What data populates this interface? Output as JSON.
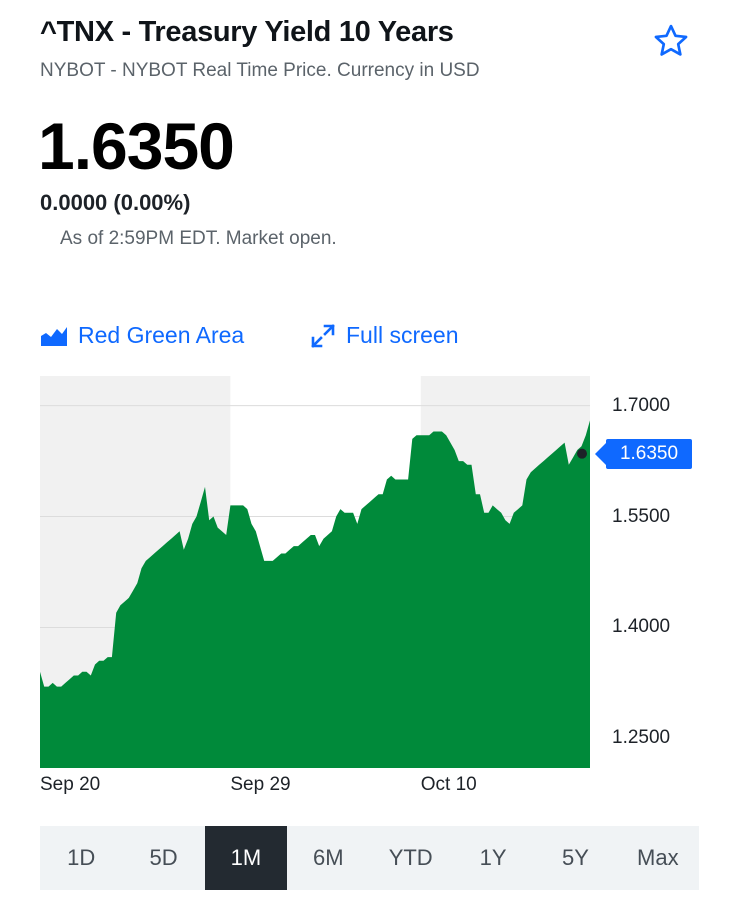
{
  "header": {
    "title": "^TNX - Treasury Yield 10 Years",
    "subtitle": "NYBOT - NYBOT Real Time Price. Currency in USD"
  },
  "quote": {
    "price": "1.6350",
    "change": "0.0000 (0.00%)",
    "as_of": "As of 2:59PM EDT. Market open."
  },
  "chart_tools": {
    "chart_type_label": "Red Green Area",
    "chart_type_icon": "area-chart-icon",
    "fullscreen_label": "Full screen",
    "fullscreen_icon": "expand-arrows-icon"
  },
  "colors": {
    "accent": "#0f69ff",
    "area_fill": "#008a3a",
    "active_range_bg": "#232a31"
  },
  "chart_data": {
    "type": "area",
    "title": "",
    "xlabel": "",
    "ylabel": "",
    "ylim": [
      1.21,
      1.74
    ],
    "yticks": [
      "1.7000",
      "1.5500",
      "1.4000",
      "1.2500"
    ],
    "ytick_values": [
      1.7,
      1.55,
      1.4,
      1.25
    ],
    "xticks": [
      "Sep 20",
      "Sep 29",
      "Oct 10"
    ],
    "xtick_index": [
      0,
      45,
      90
    ],
    "current_value": "1.6350",
    "grid": true,
    "series": [
      {
        "values": [
          1.34,
          1.32,
          1.32,
          1.325,
          1.32,
          1.32,
          1.325,
          1.33,
          1.335,
          1.335,
          1.34,
          1.34,
          1.335,
          1.35,
          1.355,
          1.355,
          1.36,
          1.36,
          1.42,
          1.43,
          1.435,
          1.44,
          1.45,
          1.46,
          1.48,
          1.49,
          1.495,
          1.5,
          1.505,
          1.51,
          1.515,
          1.52,
          1.525,
          1.53,
          1.505,
          1.52,
          1.54,
          1.55,
          1.57,
          1.59,
          1.545,
          1.55,
          1.535,
          1.53,
          1.525,
          1.565,
          1.565,
          1.565,
          1.565,
          1.56,
          1.54,
          1.53,
          1.51,
          1.49,
          1.49,
          1.49,
          1.495,
          1.5,
          1.5,
          1.505,
          1.51,
          1.51,
          1.515,
          1.52,
          1.525,
          1.525,
          1.51,
          1.52,
          1.525,
          1.53,
          1.55,
          1.56,
          1.555,
          1.555,
          1.555,
          1.54,
          1.56,
          1.565,
          1.57,
          1.575,
          1.58,
          1.58,
          1.6,
          1.605,
          1.6,
          1.6,
          1.6,
          1.6,
          1.655,
          1.66,
          1.66,
          1.66,
          1.66,
          1.665,
          1.665,
          1.665,
          1.66,
          1.65,
          1.64,
          1.625,
          1.625,
          1.62,
          1.62,
          1.58,
          1.58,
          1.555,
          1.555,
          1.565,
          1.56,
          1.555,
          1.545,
          1.54,
          1.555,
          1.56,
          1.565,
          1.6,
          1.61,
          1.615,
          1.62,
          1.625,
          1.63,
          1.635,
          1.64,
          1.645,
          1.65,
          1.62,
          1.63,
          1.64,
          1.645,
          1.66,
          1.68
        ]
      }
    ]
  },
  "range_selector": {
    "options": [
      "1D",
      "5D",
      "1M",
      "6M",
      "YTD",
      "1Y",
      "5Y",
      "Max"
    ],
    "selected": "1M"
  }
}
